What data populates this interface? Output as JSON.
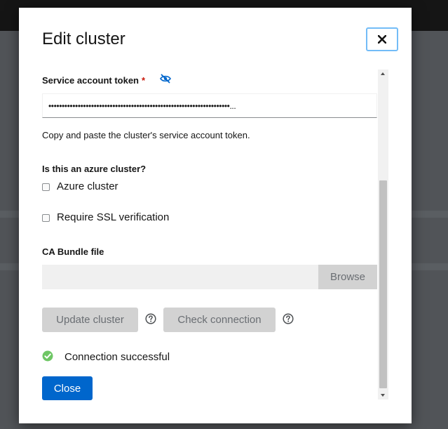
{
  "modal": {
    "title": "Edit cluster",
    "close_icon": "close-icon"
  },
  "form": {
    "token": {
      "label": "Service account token",
      "required_marker": "*",
      "visibility_icon": "eye-slash-icon",
      "value": "••••••••••••••••••••••••••••••••••••••••••••••••••••••••••••••••••••...",
      "helper": "Copy and paste the cluster's service account token."
    },
    "azure": {
      "question": "Is this an azure cluster?",
      "checkbox_label": "Azure cluster",
      "checked": false
    },
    "ssl": {
      "checkbox_label": "Require SSL verification",
      "checked": false
    },
    "ca_bundle": {
      "label": "CA Bundle file",
      "value": "",
      "browse_label": "Browse"
    }
  },
  "actions": {
    "update_label": "Update cluster",
    "check_label": "Check connection",
    "help_icon": "question-circle-icon"
  },
  "status": {
    "icon": "check-circle-icon",
    "text": "Connection successful"
  },
  "footer": {
    "close_label": "Close"
  },
  "colors": {
    "primary": "#0066cc",
    "success": "#3e8635",
    "required": "#c9190b",
    "disabled_bg": "#d2d2d2",
    "disabled_text": "#6a6e73"
  }
}
